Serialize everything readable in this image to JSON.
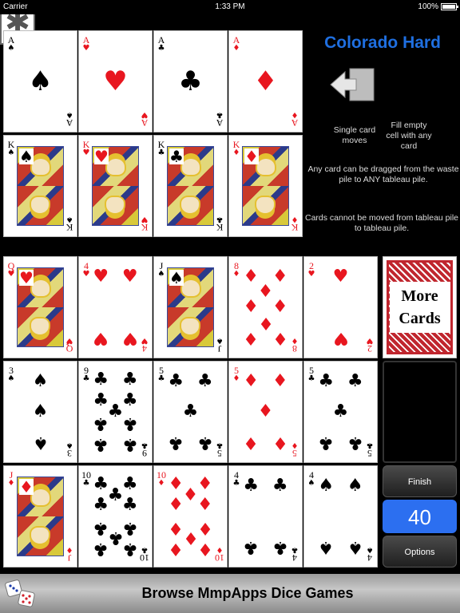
{
  "status": {
    "carrier": "Carrier",
    "time": "1:33 PM",
    "battery": "100%"
  },
  "game": {
    "title": "Colorado Hard",
    "help_single": "Single card moves",
    "help_fill": "Fill empty cell with any card",
    "help_waste": "Any card can be dragged from the waste pile to ANY tableau pile.",
    "help_tableau": "Cards cannot be moved from tableau pile to tableau pile."
  },
  "foundation_aces": [
    {
      "rank": "A",
      "suit": "♠",
      "color": "black"
    },
    {
      "rank": "A",
      "suit": "♥",
      "color": "red"
    },
    {
      "rank": "A",
      "suit": "♣",
      "color": "black"
    },
    {
      "rank": "A",
      "suit": "♦",
      "color": "red"
    }
  ],
  "foundation_kings": [
    {
      "rank": "K",
      "suit": "♠",
      "color": "black"
    },
    {
      "rank": "K",
      "suit": "♥",
      "color": "red"
    },
    {
      "rank": "K",
      "suit": "♣",
      "color": "black"
    },
    {
      "rank": "K",
      "suit": "♦",
      "color": "red"
    }
  ],
  "tableau": [
    [
      {
        "rank": "Q",
        "suit": "♥",
        "color": "red"
      },
      {
        "rank": "4",
        "suit": "♥",
        "color": "red"
      },
      {
        "rank": "J",
        "suit": "♠",
        "color": "black"
      },
      {
        "rank": "8",
        "suit": "♦",
        "color": "red"
      },
      {
        "rank": "2",
        "suit": "♥",
        "color": "red"
      }
    ],
    [
      {
        "rank": "3",
        "suit": "♠",
        "color": "black"
      },
      {
        "rank": "9",
        "suit": "♣",
        "color": "black"
      },
      {
        "rank": "5",
        "suit": "♣",
        "color": "black"
      },
      {
        "rank": "5",
        "suit": "♦",
        "color": "red"
      },
      {
        "rank": "5",
        "suit": "♣",
        "color": "black"
      }
    ],
    [
      {
        "rank": "J",
        "suit": "♦",
        "color": "red"
      },
      {
        "rank": "10",
        "suit": "♣",
        "color": "black"
      },
      {
        "rank": "10",
        "suit": "♦",
        "color": "red"
      },
      {
        "rank": "4",
        "suit": "♣",
        "color": "black"
      },
      {
        "rank": "4",
        "suit": "♠",
        "color": "black"
      }
    ]
  ],
  "deck": {
    "label_line1": "More",
    "label_line2": "Cards"
  },
  "controls": {
    "finish": "Finish",
    "score": "40",
    "options": "Options"
  },
  "banner": {
    "text": "Browse MmpApps Dice Games"
  },
  "colors": {
    "title": "#1f6fe0",
    "score_bg": "#2c6ff0",
    "red_suit": "#e8161f",
    "deck_back": "#c0262e"
  },
  "icons": {
    "arrow": "arrow-left-icon",
    "asterisk": "asterisk-icon",
    "dice": "dice-icon"
  }
}
